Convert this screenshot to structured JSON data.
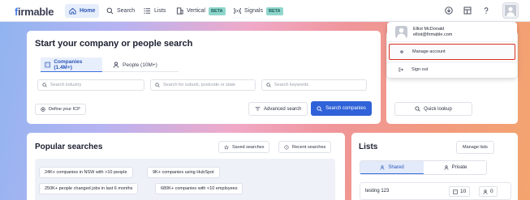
{
  "nav": {
    "logo_first": "f",
    "logo_rest": "irmable",
    "items": [
      {
        "label": "Home",
        "icon": "home-icon"
      },
      {
        "label": "Search",
        "icon": "search-icon"
      },
      {
        "label": "Lists",
        "icon": "list-icon"
      },
      {
        "label": "Vertical",
        "icon": "building-icon",
        "badge": "BETA"
      },
      {
        "label": "Signals",
        "icon": "signal-icon",
        "badge": "BETA"
      }
    ]
  },
  "search_card": {
    "title": "Start your company or people search",
    "tabs": [
      {
        "label": "Companies (1.4M+)"
      },
      {
        "label": "People (10M+)"
      }
    ],
    "inputs": {
      "industry_placeholder": "Search industry",
      "location_placeholder": "Search for suburb, postcode or state",
      "keywords_placeholder": "Search keywords"
    },
    "define_icp_label": "Define your ICP",
    "advanced_search_label": "Advanced search",
    "search_companies_label": "Search companies"
  },
  "right_card": {
    "quick_lookup_label": "Quick lookup"
  },
  "account_menu": {
    "user_name": "Elliot McDonald",
    "user_email": "elliot@firmable.com",
    "manage_account_label": "Manage account",
    "sign_out_label": "Sign out"
  },
  "popular": {
    "title": "Popular searches",
    "saved_label": "Saved searches",
    "recent_label": "Recent searches",
    "chips": [
      "24K+ companies in NSW with >10 people",
      "9K+ companies using HubSpot",
      "250K+ people changed jobs in last 6 months",
      "680K+ companies with <10 employees"
    ]
  },
  "lists": {
    "title": "Lists",
    "manage_label": "Manage lists",
    "shared_label": "Shared",
    "private_label": "Private",
    "rows": [
      {
        "name": "testing 123",
        "companies": "10",
        "people": "0"
      }
    ]
  },
  "colors": {
    "accent": "#2f62d8",
    "highlight": "#d92d20",
    "beta_badge": "#8fd6cd"
  }
}
